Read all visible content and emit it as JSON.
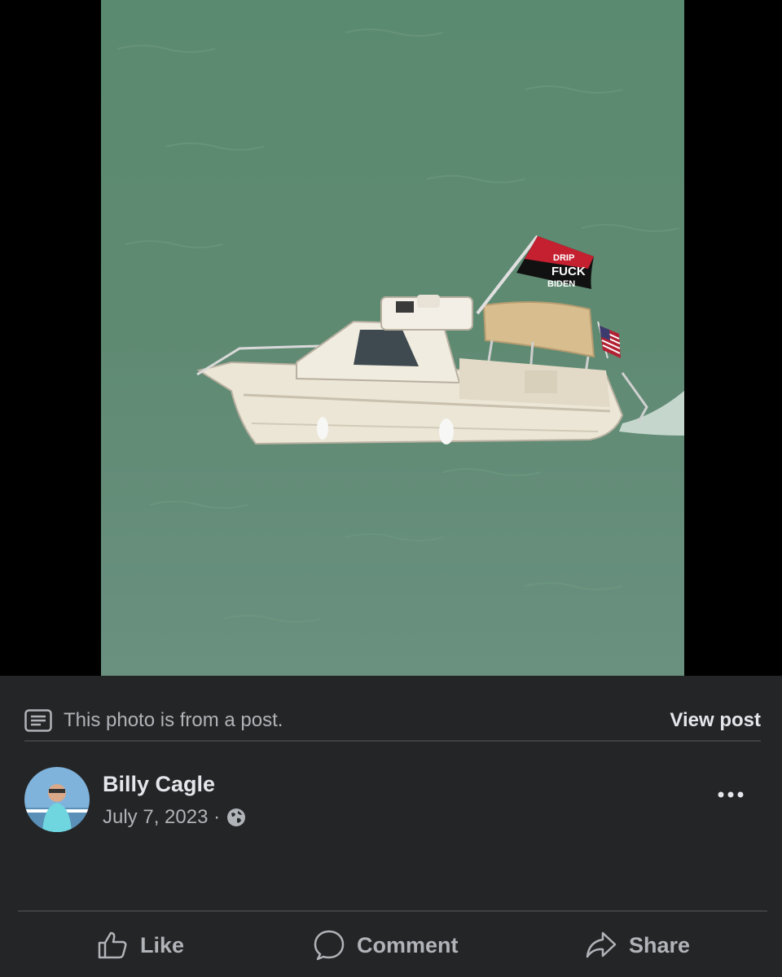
{
  "photo": {
    "subject": "boat-on-water",
    "flag_text_top": "DRIP",
    "flag_text_line1": "FUCK",
    "flag_text_line2": "BIDEN",
    "colors": {
      "water": "#5f8a72",
      "hull": "#ece6d6",
      "bimini": "#d8bd8e",
      "flag_red": "#c42030",
      "flag_black": "#111111"
    }
  },
  "notice": {
    "icon": "post-document-icon",
    "text": "This photo is from a post.",
    "view_label": "View post"
  },
  "author": {
    "name": "Billy Cagle",
    "date": "July 7, 2023 ·",
    "privacy_icon": "globe-icon",
    "more_icon": "more-options-icon"
  },
  "actions": {
    "like": {
      "label": "Like",
      "icon": "thumbs-up-icon"
    },
    "comment": {
      "label": "Comment",
      "icon": "comment-bubble-icon"
    },
    "share": {
      "label": "Share",
      "icon": "share-arrow-icon"
    }
  },
  "colors": {
    "panel_bg": "#242526",
    "text_primary": "#e4e6eb",
    "text_secondary": "#b0b3b8",
    "divider": "#3e4042"
  }
}
